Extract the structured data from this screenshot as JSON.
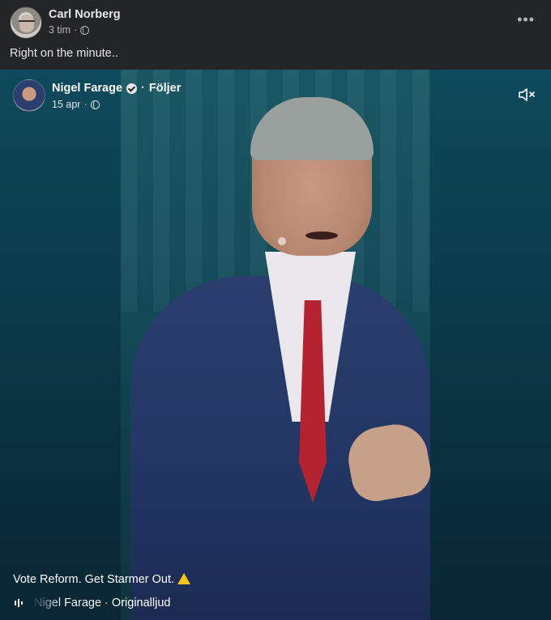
{
  "post": {
    "author": "Carl Norberg",
    "time": "3 tim",
    "separator": "·",
    "caption": "Right on the minute..",
    "more_icon": "more-horizontal-icon",
    "privacy_icon": "globe-icon"
  },
  "video": {
    "author": "Nigel Farage",
    "separator": "·",
    "follow_label": "Följer",
    "date": "15 apr",
    "caption": "Vote Reform. Get Starmer Out.",
    "caption_emoji": "warning-icon",
    "audio_author": "Nigel Farage",
    "audio_label": "Originalljud",
    "mute_icon": "speaker-muted-icon"
  },
  "colors": {
    "background": "#242526",
    "text": "#e4e6eb",
    "secondary_text": "#b0b3b8",
    "video_bg": "#0b3b4a",
    "tie": "#b52331",
    "jacket": "#223563"
  }
}
